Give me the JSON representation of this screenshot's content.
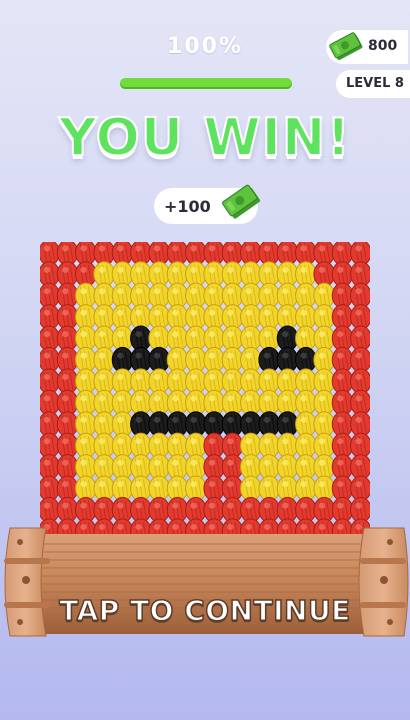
{
  "hud": {
    "progress_label": "100%",
    "progress_fraction": 1.0,
    "currency_amount": "800",
    "level_label": "LEVEL 8"
  },
  "result": {
    "title": "YOU WIN!",
    "reward_label": "+100"
  },
  "footer": {
    "continue_label": "TAP TO CONTINUE"
  },
  "icons": {
    "cash": "cash-bundle-icon"
  },
  "colors": {
    "win_green": "#5ee35f",
    "progress_green": "#71dc3a",
    "bead_red": "#e23a2e",
    "bead_yellow": "#f2d52a",
    "bead_black": "#1c1c1c",
    "wood": "#c8865a"
  },
  "board": {
    "rows": [
      "RRRRRRRRRRRRRRRRRR",
      "RRRYYYYYYYYYYYYRRR",
      "RRYYYYYYYYYYYYYYRR",
      "RRYYYYYYYYYYYYYYRR",
      "RRYYYBYYYYYYYBYYRR",
      "RRYYBBBYYYYYBBBYRR",
      "RRYYYYYYYYYYYYYYRR",
      "RRYYYYYYYYYYYYYYRR",
      "RRYYYBBBBBBBBBYYRR",
      "RRYYYYYYYRRYYYYYRR",
      "RRYYYYYYYRRYYYYYRR",
      "RRYYYYYYYRRYYYYYRR",
      "RRRRRRRRRRRRRRRRRR",
      "RRRRRRRRRRRRRRRRRR"
    ]
  }
}
